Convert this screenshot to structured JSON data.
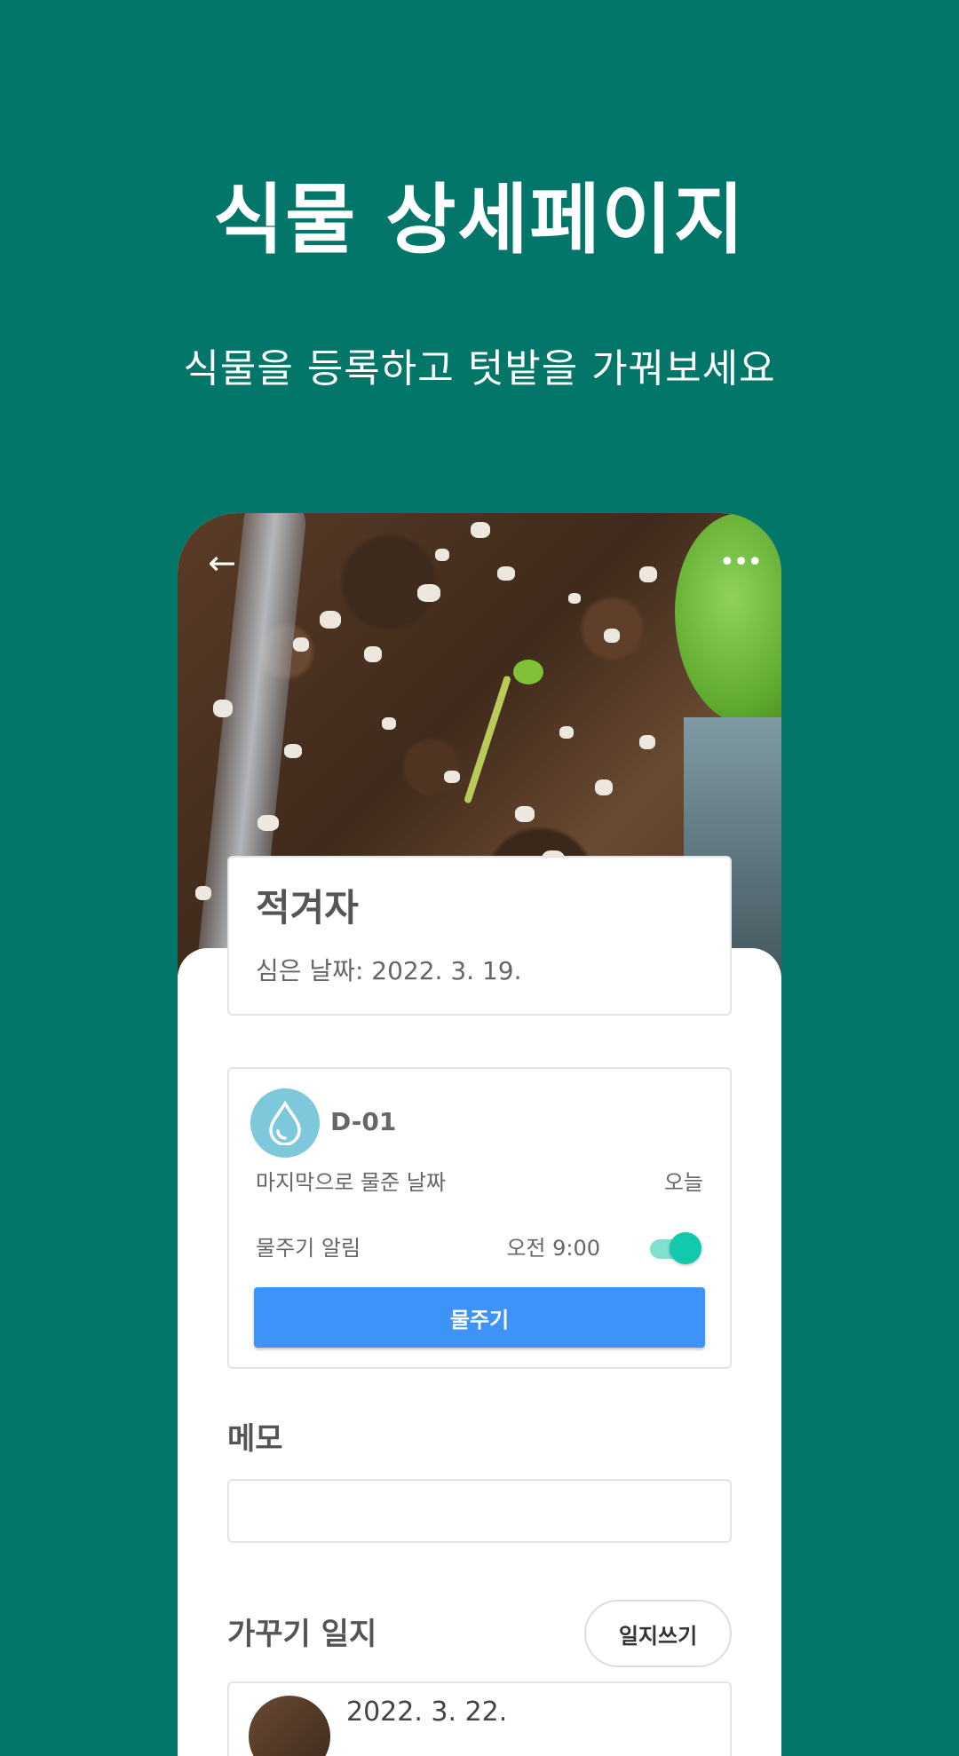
{
  "promo": {
    "title": "식물 상세페이지",
    "subtitle": "식물을 등록하고 텃밭을 가꿔보세요"
  },
  "header": {
    "back_icon": "arrow-left-icon",
    "more_icon": "more-horizontal-icon"
  },
  "plant": {
    "name": "적겨자",
    "planted_date": "심은 날짜: 2022. 3. 19."
  },
  "watering": {
    "icon": "water-drop-icon",
    "device_id": "D-01",
    "last_watered_label": "마지막으로 물준 날짜",
    "last_watered_value": "오늘",
    "alarm_label": "물주기 알림",
    "alarm_time": "오전 9:00",
    "alarm_enabled": true,
    "button_label": "물주기"
  },
  "memo": {
    "title": "메모",
    "value": ""
  },
  "journal": {
    "title": "가꾸기 일지",
    "write_button_label": "일지쓰기",
    "entries": [
      {
        "date": "2022. 3. 22."
      }
    ]
  },
  "colors": {
    "background": "#03766a",
    "primary_button": "#3d93f8",
    "toggle_on": "#12c9ae",
    "drop_icon_bg": "#7ec8dc"
  }
}
